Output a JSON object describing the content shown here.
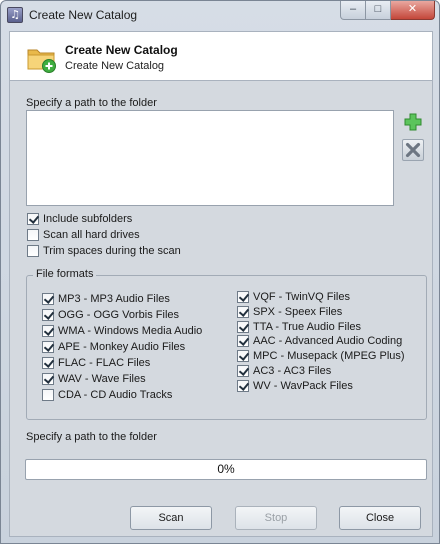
{
  "window": {
    "title": "Create New Catalog",
    "app_icon_glyph": "♫"
  },
  "caption": {
    "minimize": "–",
    "maximize": "□",
    "close": "✕"
  },
  "header": {
    "title": "Create New Catalog",
    "subtitle": "Create New Catalog",
    "icon": "folder-add-icon"
  },
  "path_section": {
    "label": "Specify a path to the folder",
    "paths": []
  },
  "side_buttons": {
    "add_icon": "plus-icon",
    "remove_icon": "remove-icon"
  },
  "options": [
    {
      "label": "Include subfolders",
      "checked": true
    },
    {
      "label": "Scan all hard drives",
      "checked": false
    },
    {
      "label": "Trim spaces during the scan",
      "checked": false
    }
  ],
  "formats": {
    "title": "File formats",
    "left": [
      {
        "label": "MP3 - MP3 Audio Files",
        "checked": true
      },
      {
        "label": "OGG - OGG Vorbis Files",
        "checked": true
      },
      {
        "label": "WMA - Windows Media Audio",
        "checked": true
      },
      {
        "label": "APE - Monkey Audio Files",
        "checked": true
      },
      {
        "label": "FLAC - FLAC Files",
        "checked": true
      },
      {
        "label": "WAV - Wave Files",
        "checked": true
      },
      {
        "label": "CDA - CD Audio Tracks",
        "checked": false
      }
    ],
    "right": [
      {
        "label": "VQF - TwinVQ Files",
        "checked": true
      },
      {
        "label": "SPX - Speex Files",
        "checked": true
      },
      {
        "label": "TTA - True Audio Files",
        "checked": true
      },
      {
        "label": "AAC - Advanced Audio Coding",
        "checked": true
      },
      {
        "label": "MPC - Musepack (MPEG Plus)",
        "checked": true
      },
      {
        "label": "AC3 - AC3 Files",
        "checked": true
      },
      {
        "label": "WV - WavPack Files",
        "checked": true
      }
    ]
  },
  "status": {
    "text": "Specify a path to the folder"
  },
  "progress": {
    "value": 0,
    "text": "0%"
  },
  "buttons": {
    "scan": {
      "label": "Scan",
      "enabled": true
    },
    "stop": {
      "label": "Stop",
      "enabled": false
    },
    "close": {
      "label": "Close",
      "enabled": true
    }
  },
  "colors": {
    "accent_green": "#4cbf4c",
    "folder_yellow": "#f2c94c"
  }
}
